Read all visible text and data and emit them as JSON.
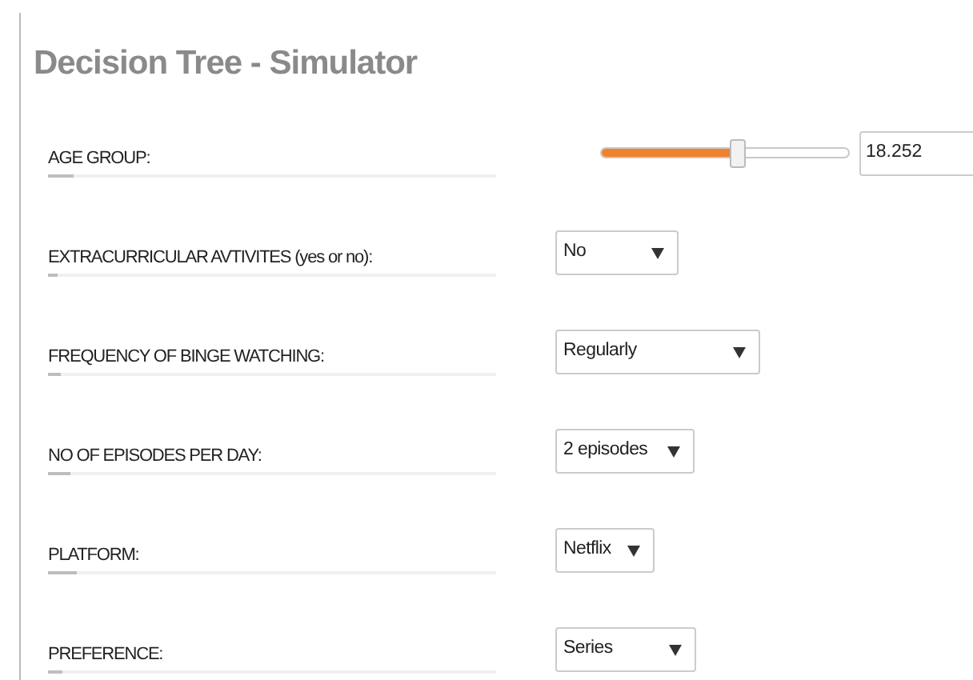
{
  "title": "Decision Tree - Simulator",
  "fields": [
    {
      "kind": "slider",
      "label": "AGE GROUP:",
      "level": 0.55,
      "value": "18.252",
      "underline": {
        "level": 0.057
      }
    },
    {
      "kind": "select",
      "label": "EXTRACURRICULAR AVTIVITES (yes or no):",
      "value": "No",
      "underline": {
        "level": 0.021
      }
    },
    {
      "kind": "select",
      "label": "FREQUENCY OF BINGE WATCHING:",
      "value": "Regularly",
      "underline": {
        "level": 0.029
      }
    },
    {
      "kind": "select",
      "label": "NO OF EPISODES PER DAY:",
      "value": "2 episodes",
      "underline": {
        "level": 0.05
      }
    },
    {
      "kind": "select",
      "label": "PLATFORM:",
      "value": "Netflix",
      "underline": {
        "level": 0.064
      }
    },
    {
      "kind": "select",
      "label": "PREFERENCE:",
      "value": "Series",
      "underline": {
        "level": 0.032
      }
    }
  ]
}
